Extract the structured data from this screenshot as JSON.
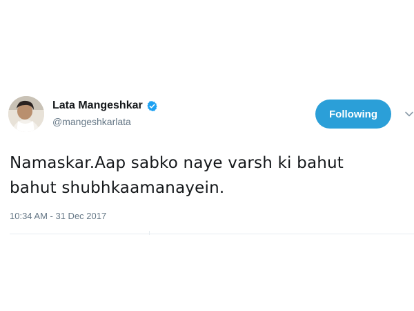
{
  "tweet": {
    "author": {
      "display_name": "Lata Mangeshkar",
      "handle": "@mangeshkarlata",
      "verified": true,
      "avatar_icon": "user-avatar-photo"
    },
    "follow_button_label": "Following",
    "text_lines": [
      "Namaskar.Aap sabko naye varsh ki bahut",
      "bahut shubhkaamanayein."
    ],
    "timestamp": "10:34 AM - 31 Dec 2017"
  },
  "colors": {
    "accent": "#2b9fd8",
    "verified_badge": "#1da1f2",
    "secondary_text": "#657786",
    "primary_text": "#14171a"
  },
  "icons": {
    "verified": "verified-badge-icon",
    "more": "chevron-down-icon"
  }
}
